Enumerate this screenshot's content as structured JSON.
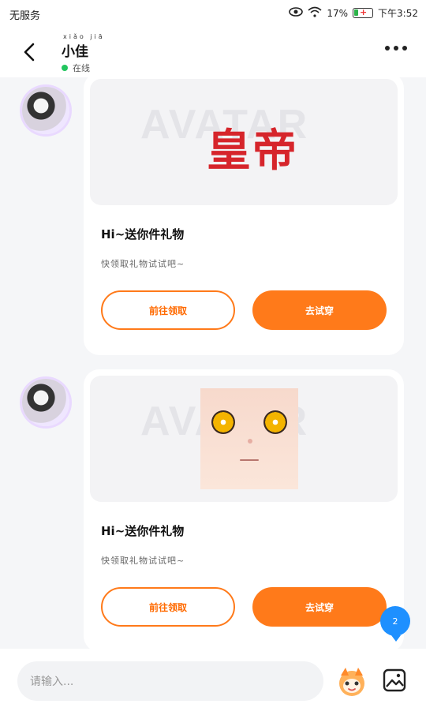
{
  "status_bar": {
    "carrier": "无服务",
    "battery_percent": "17%",
    "time": "下午3:52"
  },
  "header": {
    "name": "小佳",
    "name_ruby": "xiǎo jiā",
    "status": "在线"
  },
  "messages": [
    {
      "image_caption": "皇帝",
      "bg_text": "AVATAR",
      "title": "Hi~送你件礼物",
      "subtitle": "快领取礼物试试吧~",
      "btn_receive": "前往领取",
      "btn_try": "去试穿"
    },
    {
      "image_caption": "",
      "bg_text": "AVATAR",
      "title": "Hi~送你件礼物",
      "subtitle": "快领取礼物试试吧~",
      "btn_receive": "前往领取",
      "btn_try": "去试穿"
    }
  ],
  "unread_badge": "2",
  "input": {
    "placeholder": "请输入..."
  },
  "colors": {
    "accent": "#ff7a1a",
    "badge": "#1e90ff",
    "online": "#22c55e"
  }
}
